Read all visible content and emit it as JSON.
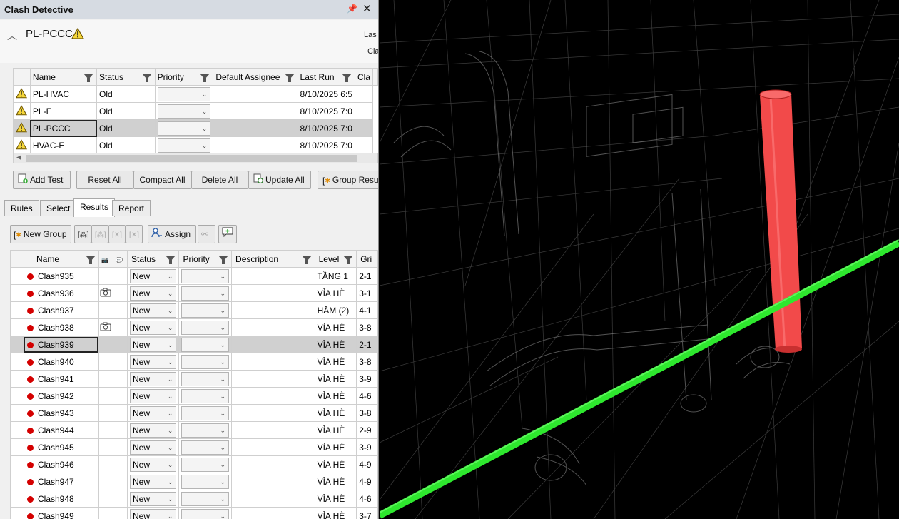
{
  "window": {
    "title": "Clash Detective"
  },
  "test_header": {
    "name": "PL-PCCC",
    "last_run_label": "Las",
    "clash_label": "Cla"
  },
  "tests_table": {
    "columns": [
      "Name",
      "Status",
      "Priority",
      "Default Assignee",
      "Last Run",
      "Cla"
    ],
    "rows": [
      {
        "name": "PL-HVAC",
        "status": "Old",
        "last_run": "8/10/2025 6:5"
      },
      {
        "name": "PL-E",
        "status": "Old",
        "last_run": "8/10/2025 7:0"
      },
      {
        "name": "PL-PCCC",
        "status": "Old",
        "last_run": "8/10/2025 7:0"
      },
      {
        "name": "HVAC-E",
        "status": "Old",
        "last_run": "8/10/2025 7:0"
      }
    ]
  },
  "toolbar": {
    "add_test": "Add Test",
    "reset_all": "Reset All",
    "compact_all": "Compact All",
    "delete_all": "Delete All",
    "update_all": "Update All",
    "group_results": "Group Resu"
  },
  "tabs": [
    "Rules",
    "Select",
    "Results",
    "Report"
  ],
  "results_toolbar": {
    "new_group": "New Group",
    "assign": "Assign"
  },
  "results_table": {
    "columns": [
      "Name",
      "Status",
      "Priority",
      "Description",
      "Level",
      "Gri"
    ],
    "rows": [
      {
        "name": "Clash935",
        "status": "New",
        "level": "TẦNG 1",
        "grid": "2-1",
        "camera": false
      },
      {
        "name": "Clash936",
        "status": "New",
        "level": "VỈA HÈ",
        "grid": "3-1",
        "camera": true
      },
      {
        "name": "Clash937",
        "status": "New",
        "level": "HẦM (2)",
        "grid": "4-1",
        "camera": false
      },
      {
        "name": "Clash938",
        "status": "New",
        "level": "VỈA HÈ",
        "grid": "3-8",
        "camera": true
      },
      {
        "name": "Clash939",
        "status": "New",
        "level": "VỈA HÈ",
        "grid": "2-1",
        "camera": false
      },
      {
        "name": "Clash940",
        "status": "New",
        "level": "VỈA HÈ",
        "grid": "3-8",
        "camera": false
      },
      {
        "name": "Clash941",
        "status": "New",
        "level": "VỈA HÈ",
        "grid": "3-9",
        "camera": false
      },
      {
        "name": "Clash942",
        "status": "New",
        "level": "VỈA HÈ",
        "grid": "4-6",
        "camera": false
      },
      {
        "name": "Clash943",
        "status": "New",
        "level": "VỈA HÈ",
        "grid": "3-8",
        "camera": false
      },
      {
        "name": "Clash944",
        "status": "New",
        "level": "VỈA HÈ",
        "grid": "2-9",
        "camera": false
      },
      {
        "name": "Clash945",
        "status": "New",
        "level": "VỈA HÈ",
        "grid": "3-9",
        "camera": false
      },
      {
        "name": "Clash946",
        "status": "New",
        "level": "VỈA HÈ",
        "grid": "4-9",
        "camera": false
      },
      {
        "name": "Clash947",
        "status": "New",
        "level": "VỈA HÈ",
        "grid": "4-9",
        "camera": false
      },
      {
        "name": "Clash948",
        "status": "New",
        "level": "VỈA HÈ",
        "grid": "4-6",
        "camera": false
      },
      {
        "name": "Clash949",
        "status": "New",
        "level": "VỈA HÈ",
        "grid": "3-7",
        "camera": false
      }
    ]
  },
  "colors": {
    "clash_dot": "#d40000",
    "red_pipe": "#f24a4a",
    "green_pipe": "#2ee82e"
  },
  "icons": [
    "warning-icon",
    "pin-icon",
    "close-icon",
    "filter-icon",
    "camera-icon",
    "comment-icon"
  ]
}
